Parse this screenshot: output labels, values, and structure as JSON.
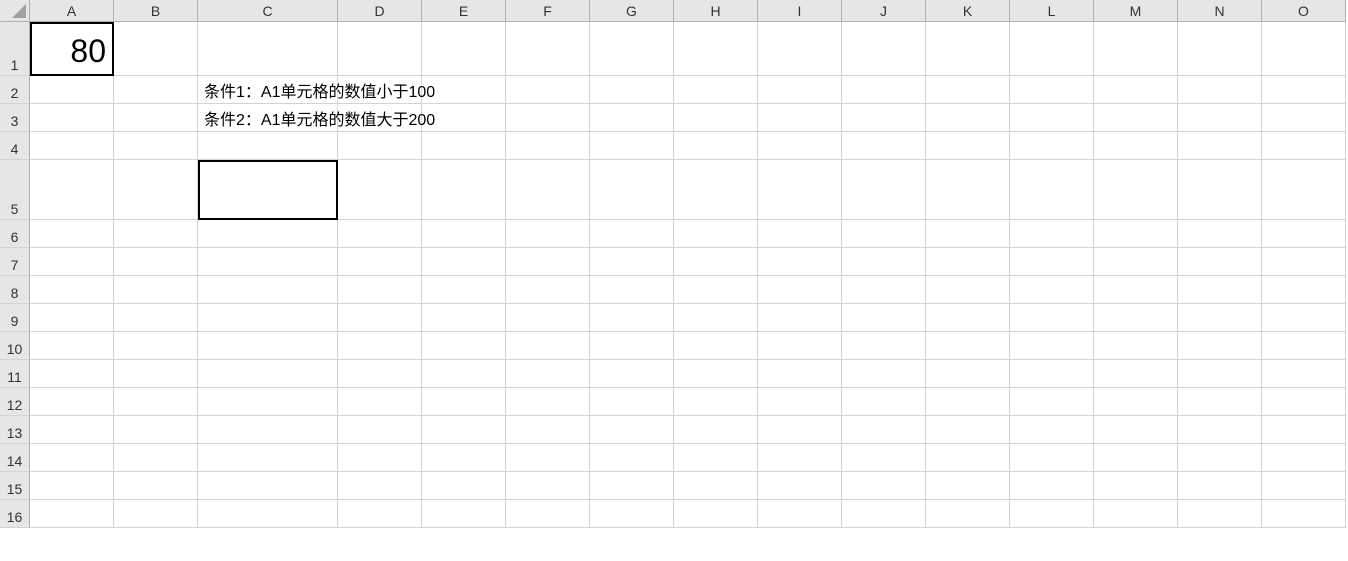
{
  "columns": [
    "A",
    "B",
    "C",
    "D",
    "E",
    "F",
    "G",
    "H",
    "I",
    "J",
    "K",
    "L",
    "M",
    "N",
    "O"
  ],
  "rows": [
    "1",
    "2",
    "3",
    "4",
    "5",
    "6",
    "7",
    "8",
    "9",
    "10",
    "11",
    "12",
    "13",
    "14",
    "15",
    "16"
  ],
  "columnWidths": {
    "rowHeader": 30,
    "A": 84,
    "B": 84,
    "C": 140,
    "D": 84,
    "E": 84,
    "F": 84,
    "G": 84,
    "H": 84,
    "I": 84,
    "J": 84,
    "K": 84,
    "L": 84,
    "M": 84,
    "N": 84,
    "O": 84
  },
  "rowHeights": {
    "header": 22,
    "1": 54,
    "2": 28,
    "3": 28,
    "4": 28,
    "5": 60,
    "6": 28,
    "7": 28,
    "8": 28,
    "9": 28,
    "10": 28,
    "11": 28,
    "12": 28,
    "13": 28,
    "14": 28,
    "15": 28,
    "16": 28
  },
  "cells": {
    "A1": "80",
    "C2": "条件1：A1单元格的数值小于100",
    "C3": "条件2：A1单元格的数值大于200"
  },
  "boldBorderCells": [
    "A1",
    "C5"
  ]
}
